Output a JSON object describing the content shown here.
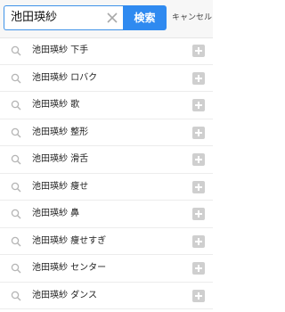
{
  "search": {
    "query": "池田瑛紗",
    "button_label": "検索",
    "cancel_label": "キャンセル",
    "clear_icon": "close-icon"
  },
  "suggestions": [
    {
      "label": "池田瑛紗 下手"
    },
    {
      "label": "池田瑛紗 ロバク"
    },
    {
      "label": "池田瑛紗 歌"
    },
    {
      "label": "池田瑛紗 整形"
    },
    {
      "label": "池田瑛紗 滑舌"
    },
    {
      "label": "池田瑛紗 痩せ"
    },
    {
      "label": "池田瑛紗 鼻"
    },
    {
      "label": "池田瑛紗 痩せすぎ"
    },
    {
      "label": "池田瑛紗 センター"
    },
    {
      "label": "池田瑛紗 ダンス"
    }
  ],
  "colors": {
    "accent": "#2f8af0",
    "plus_button": "#cfcfcf",
    "icon": "#b5b5b5"
  }
}
